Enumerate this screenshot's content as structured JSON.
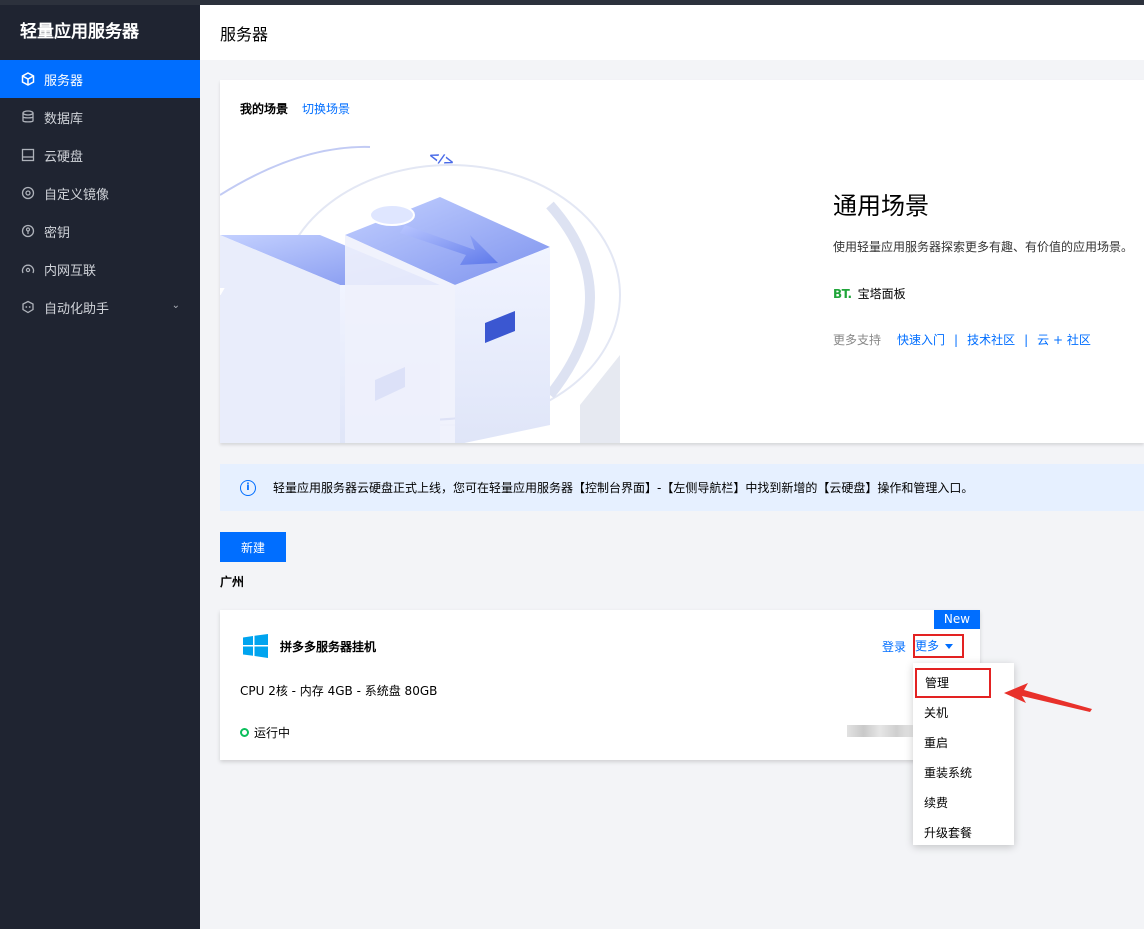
{
  "sidebar": {
    "title": "轻量应用服务器",
    "items": [
      {
        "label": "服务器",
        "icon": "cube-icon",
        "active": true
      },
      {
        "label": "数据库",
        "icon": "database-icon"
      },
      {
        "label": "云硬盘",
        "icon": "disk-icon"
      },
      {
        "label": "自定义镜像",
        "icon": "image-icon"
      },
      {
        "label": "密钥",
        "icon": "key-icon"
      },
      {
        "label": "内网互联",
        "icon": "network-icon"
      },
      {
        "label": "自动化助手",
        "icon": "robot-icon",
        "has_children": true
      }
    ]
  },
  "header": {
    "title": "服务器"
  },
  "scene": {
    "my_scene": "我的场景",
    "switch_scene": "切换场景",
    "name": "通用场景",
    "description": "使用轻量应用服务器探索更多有趣、有价值的应用场景。",
    "bt_logo": "BT.",
    "bt_label": "宝塔面板",
    "more_support": "更多支持",
    "links": [
      "快速入门",
      "技术社区",
      "云 + 社区"
    ],
    "code_glyph": "</>"
  },
  "notice": {
    "text": "轻量应用服务器云硬盘正式上线，您可在轻量应用服务器【控制台界面】-【左侧导航栏】中找到新增的【云硬盘】操作和管理入口。"
  },
  "new_button": "新建",
  "region": "广州",
  "server": {
    "badge": "New",
    "name": "拼多多服务器挂机",
    "login": "登录",
    "more": "更多",
    "spec": "CPU 2核 - 内存 4GB - 系统盘 80GB",
    "status": "运行中"
  },
  "dropdown": {
    "options": [
      "管理",
      "关机",
      "重启",
      "重装系统",
      "续费",
      "升级套餐"
    ]
  },
  "colors": {
    "primary": "#006eff",
    "sidebar": "#1f2431",
    "highlight": "#e32222",
    "running": "#0abf5b"
  }
}
